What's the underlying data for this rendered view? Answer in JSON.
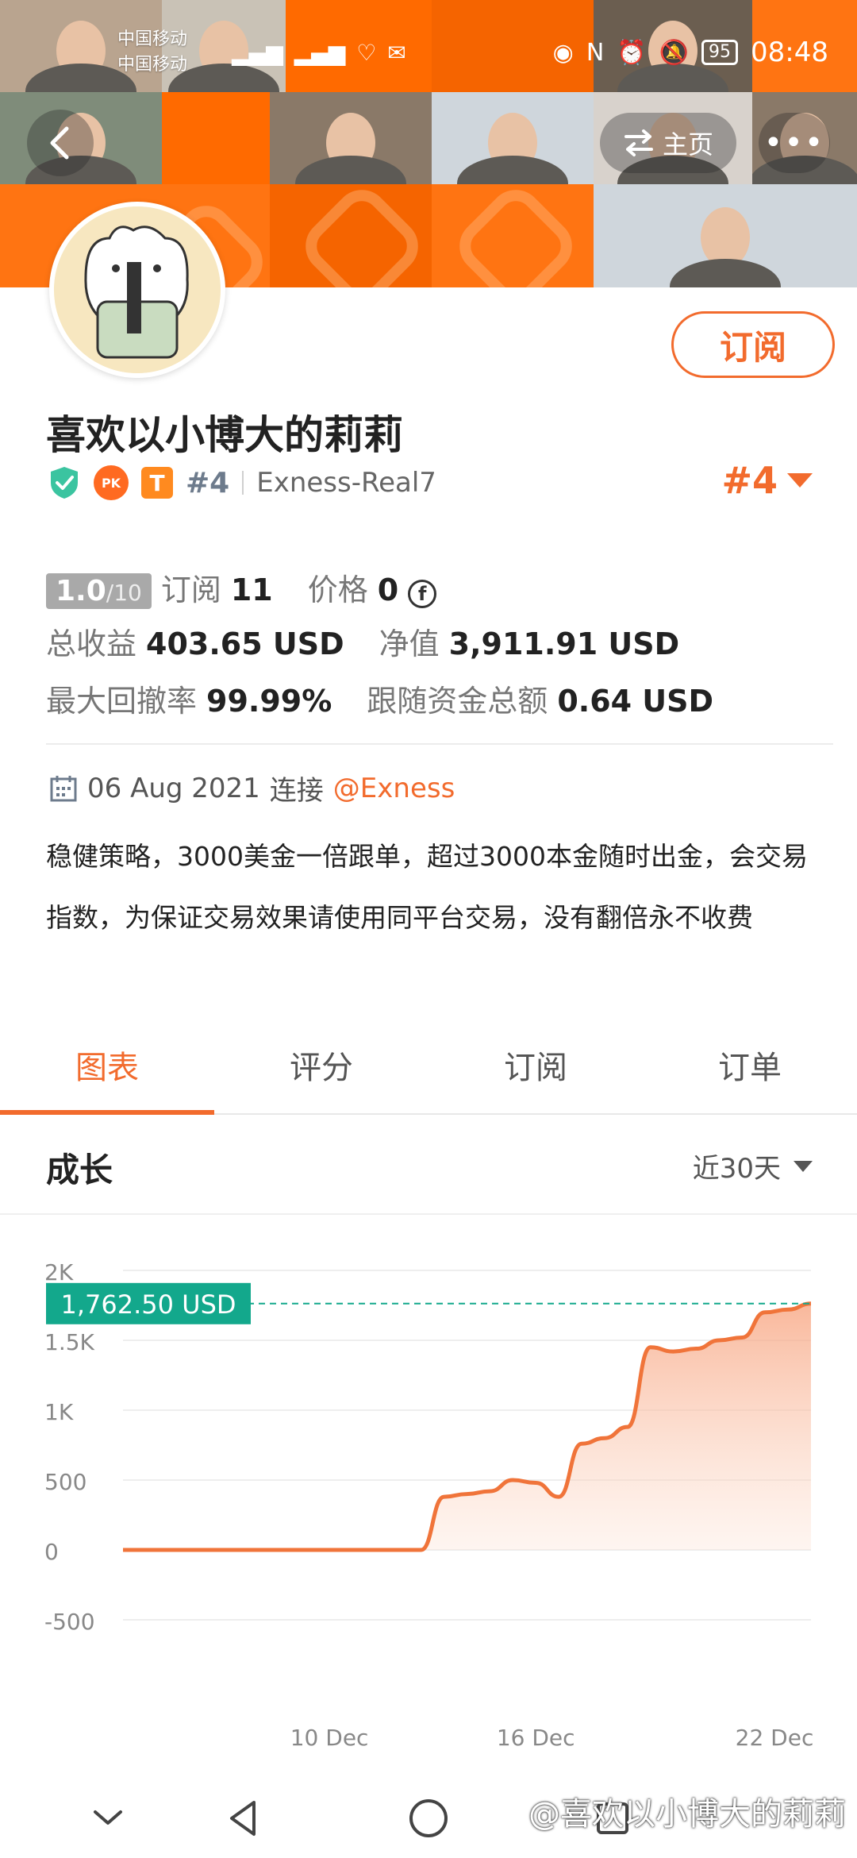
{
  "status_bar": {
    "carrier_1": "中国移动",
    "carrier_2": "中国移动",
    "battery": "95",
    "time": "08:48"
  },
  "header": {
    "home_label": "主页",
    "more_label": "•••"
  },
  "profile": {
    "name": "喜欢以小博大的莉莉",
    "subscribe_label": "订阅",
    "rank_small": "#4",
    "server": "Exness-Real7",
    "rank_big": "#4",
    "score": "1.0",
    "score_max": "/10",
    "subscribe_count_label": "订阅",
    "subscribe_count": "11",
    "price_label": "价格",
    "price": "0",
    "total_profit_label": "总收益",
    "total_profit": "403.65 USD",
    "net_value_label": "净值",
    "net_value": "3,911.91 USD",
    "max_drawdown_label": "最大回撤率",
    "max_drawdown": "99.99%",
    "follow_total_label": "跟随资金总额",
    "follow_total": "0.64 USD",
    "connect_date": "06 Aug 2021",
    "connect_label": "连接",
    "broker": "@Exness",
    "description": "稳健策略，3000美金一倍跟单，超过3000本金随时出金，会交易指数，为保证交易效果请使用同平台交易，没有翻倍永不收费"
  },
  "tabs": [
    {
      "label": "图表",
      "active": true
    },
    {
      "label": "评分",
      "active": false
    },
    {
      "label": "订阅",
      "active": false
    },
    {
      "label": "订单",
      "active": false
    }
  ],
  "section": {
    "title": "成长",
    "range": "近30天"
  },
  "chart_data": {
    "type": "area",
    "title": "成长",
    "ylim": [
      -500,
      2000
    ],
    "y_ticks": [
      "2K",
      "1.5K",
      "1K",
      "500",
      "0",
      "-500"
    ],
    "y_tick_values": [
      2000,
      1500,
      1000,
      500,
      0,
      -500
    ],
    "x_ticks": [
      "10 Dec",
      "16 Dec",
      "22 Dec"
    ],
    "current_label": "1,762.50 USD",
    "current_value": 1762.5,
    "series": [
      {
        "values": [
          0,
          0,
          0,
          0,
          0,
          0,
          0,
          0,
          0,
          0,
          0,
          0,
          0,
          0,
          380,
          400,
          420,
          500,
          480,
          380,
          760,
          800,
          880,
          1450,
          1420,
          1440,
          1500,
          1520,
          1700,
          1720,
          1762.5
        ]
      }
    ],
    "colors": {
      "line": "#f0743a",
      "fill": "#f7a07a",
      "label_bg": "#13a88c",
      "grid": "#eeeeee"
    }
  },
  "watermark": "@喜欢以小博大的莉莉"
}
